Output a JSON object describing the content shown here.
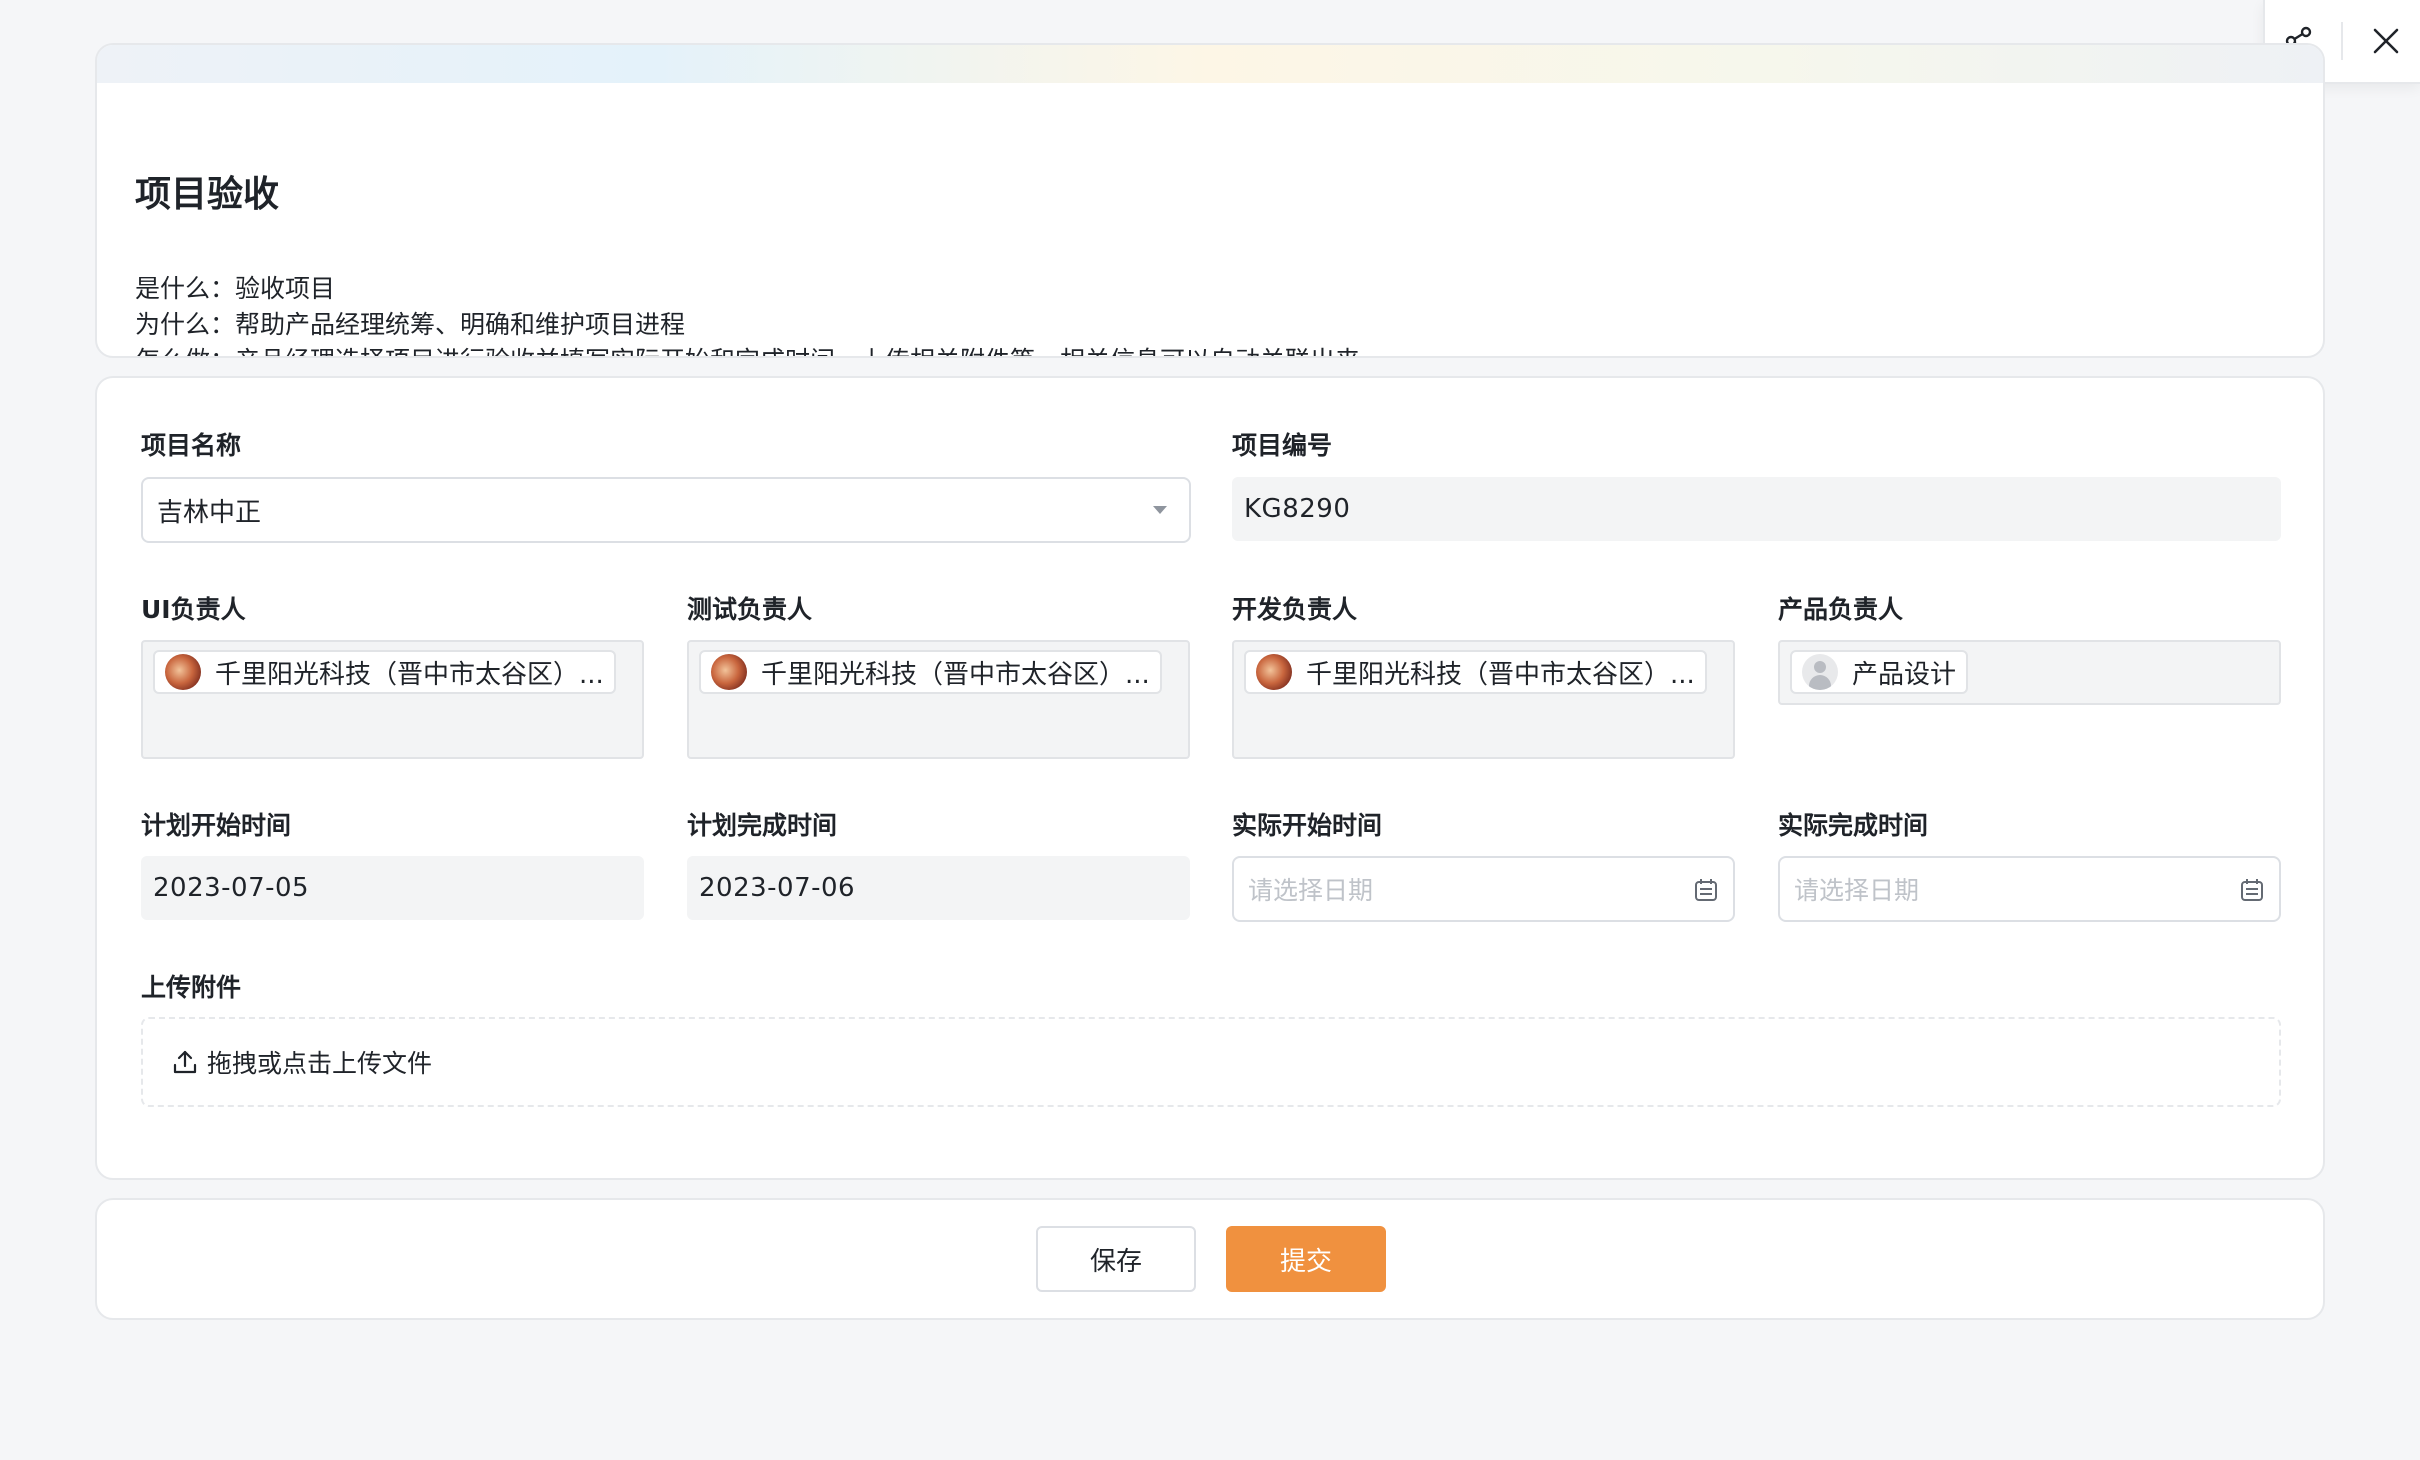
{
  "toolbar": {
    "share_icon": "share-icon",
    "close_icon": "close-icon"
  },
  "intro": {
    "title": "项目验收",
    "lines": [
      {
        "key": "是什么：",
        "value": "验收项目"
      },
      {
        "key": "为什么：",
        "value": "帮助产品经理统筹、明确和维护项目进程"
      },
      {
        "key": "怎么做：",
        "value": "产品经理选择项目进行验收并填写实际开始和完成时间，上传相关附件等，相关信息可以自动关联出来"
      }
    ]
  },
  "form": {
    "project_name": {
      "label": "项目名称",
      "value": "吉林中正"
    },
    "project_code": {
      "label": "项目编号",
      "value": "KG8290"
    },
    "ui_owner": {
      "label": "UI负责人",
      "person": "千里阳光科技（晋中市太谷区）..."
    },
    "test_owner": {
      "label": "测试负责人",
      "person": "千里阳光科技（晋中市太谷区）..."
    },
    "dev_owner": {
      "label": "开发负责人",
      "person": "千里阳光科技（晋中市太谷区）..."
    },
    "product_owner": {
      "label": "产品负责人",
      "person": "产品设计"
    },
    "plan_start": {
      "label": "计划开始时间",
      "value": "2023-07-05"
    },
    "plan_end": {
      "label": "计划完成时间",
      "value": "2023-07-06"
    },
    "actual_start": {
      "label": "实际开始时间",
      "placeholder": "请选择日期"
    },
    "actual_end": {
      "label": "实际完成时间",
      "placeholder": "请选择日期"
    },
    "attachment": {
      "label": "上传附件",
      "hint": "拖拽或点击上传文件"
    }
  },
  "actions": {
    "save": "保存",
    "submit": "提交"
  },
  "colors": {
    "accent": "#f0913f",
    "background": "#f5f6f8"
  }
}
